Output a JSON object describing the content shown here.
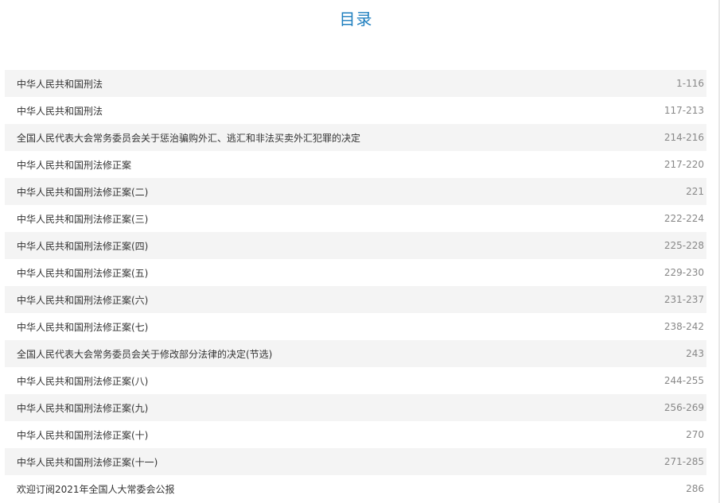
{
  "title": "目录",
  "entries": [
    {
      "name": "中华人民共和国刑法",
      "pages": "1-116"
    },
    {
      "name": "中华人民共和国刑法",
      "pages": "117-213"
    },
    {
      "name": "全国人民代表大会常务委员会关于惩治骗购外汇、逃汇和非法买卖外汇犯罪的决定",
      "pages": "214-216"
    },
    {
      "name": "中华人民共和国刑法修正案",
      "pages": "217-220"
    },
    {
      "name": "中华人民共和国刑法修正案(二)",
      "pages": "221"
    },
    {
      "name": "中华人民共和国刑法修正案(三)",
      "pages": "222-224"
    },
    {
      "name": "中华人民共和国刑法修正案(四)",
      "pages": "225-228"
    },
    {
      "name": "中华人民共和国刑法修正案(五)",
      "pages": "229-230"
    },
    {
      "name": "中华人民共和国刑法修正案(六)",
      "pages": "231-237"
    },
    {
      "name": "中华人民共和国刑法修正案(七)",
      "pages": "238-242"
    },
    {
      "name": "全国人民代表大会常务委员会关于修改部分法律的决定(节选)",
      "pages": "243"
    },
    {
      "name": "中华人民共和国刑法修正案(八)",
      "pages": "244-255"
    },
    {
      "name": "中华人民共和国刑法修正案(九)",
      "pages": "256-269"
    },
    {
      "name": "中华人民共和国刑法修正案(十)",
      "pages": "270"
    },
    {
      "name": "中华人民共和国刑法修正案(十一)",
      "pages": "271-285"
    },
    {
      "name": "欢迎订阅2021年全国人大常委会公报",
      "pages": "286"
    }
  ]
}
